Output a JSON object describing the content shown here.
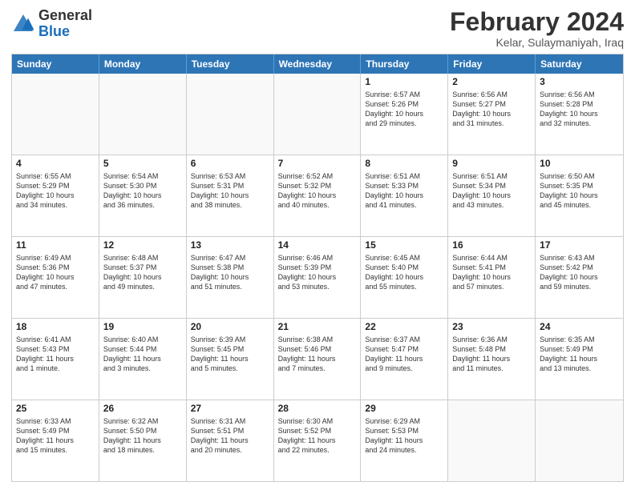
{
  "header": {
    "logo": {
      "general": "General",
      "blue": "Blue"
    },
    "title": "February 2024",
    "location": "Kelar, Sulaymaniyah, Iraq"
  },
  "weekdays": [
    "Sunday",
    "Monday",
    "Tuesday",
    "Wednesday",
    "Thursday",
    "Friday",
    "Saturday"
  ],
  "rows": [
    [
      {
        "day": "",
        "info": "",
        "empty": true
      },
      {
        "day": "",
        "info": "",
        "empty": true
      },
      {
        "day": "",
        "info": "",
        "empty": true
      },
      {
        "day": "",
        "info": "",
        "empty": true
      },
      {
        "day": "1",
        "info": "Sunrise: 6:57 AM\nSunset: 5:26 PM\nDaylight: 10 hours\nand 29 minutes."
      },
      {
        "day": "2",
        "info": "Sunrise: 6:56 AM\nSunset: 5:27 PM\nDaylight: 10 hours\nand 31 minutes."
      },
      {
        "day": "3",
        "info": "Sunrise: 6:56 AM\nSunset: 5:28 PM\nDaylight: 10 hours\nand 32 minutes."
      }
    ],
    [
      {
        "day": "4",
        "info": "Sunrise: 6:55 AM\nSunset: 5:29 PM\nDaylight: 10 hours\nand 34 minutes."
      },
      {
        "day": "5",
        "info": "Sunrise: 6:54 AM\nSunset: 5:30 PM\nDaylight: 10 hours\nand 36 minutes."
      },
      {
        "day": "6",
        "info": "Sunrise: 6:53 AM\nSunset: 5:31 PM\nDaylight: 10 hours\nand 38 minutes."
      },
      {
        "day": "7",
        "info": "Sunrise: 6:52 AM\nSunset: 5:32 PM\nDaylight: 10 hours\nand 40 minutes."
      },
      {
        "day": "8",
        "info": "Sunrise: 6:51 AM\nSunset: 5:33 PM\nDaylight: 10 hours\nand 41 minutes."
      },
      {
        "day": "9",
        "info": "Sunrise: 6:51 AM\nSunset: 5:34 PM\nDaylight: 10 hours\nand 43 minutes."
      },
      {
        "day": "10",
        "info": "Sunrise: 6:50 AM\nSunset: 5:35 PM\nDaylight: 10 hours\nand 45 minutes."
      }
    ],
    [
      {
        "day": "11",
        "info": "Sunrise: 6:49 AM\nSunset: 5:36 PM\nDaylight: 10 hours\nand 47 minutes."
      },
      {
        "day": "12",
        "info": "Sunrise: 6:48 AM\nSunset: 5:37 PM\nDaylight: 10 hours\nand 49 minutes."
      },
      {
        "day": "13",
        "info": "Sunrise: 6:47 AM\nSunset: 5:38 PM\nDaylight: 10 hours\nand 51 minutes."
      },
      {
        "day": "14",
        "info": "Sunrise: 6:46 AM\nSunset: 5:39 PM\nDaylight: 10 hours\nand 53 minutes."
      },
      {
        "day": "15",
        "info": "Sunrise: 6:45 AM\nSunset: 5:40 PM\nDaylight: 10 hours\nand 55 minutes."
      },
      {
        "day": "16",
        "info": "Sunrise: 6:44 AM\nSunset: 5:41 PM\nDaylight: 10 hours\nand 57 minutes."
      },
      {
        "day": "17",
        "info": "Sunrise: 6:43 AM\nSunset: 5:42 PM\nDaylight: 10 hours\nand 59 minutes."
      }
    ],
    [
      {
        "day": "18",
        "info": "Sunrise: 6:41 AM\nSunset: 5:43 PM\nDaylight: 11 hours\nand 1 minute."
      },
      {
        "day": "19",
        "info": "Sunrise: 6:40 AM\nSunset: 5:44 PM\nDaylight: 11 hours\nand 3 minutes."
      },
      {
        "day": "20",
        "info": "Sunrise: 6:39 AM\nSunset: 5:45 PM\nDaylight: 11 hours\nand 5 minutes."
      },
      {
        "day": "21",
        "info": "Sunrise: 6:38 AM\nSunset: 5:46 PM\nDaylight: 11 hours\nand 7 minutes."
      },
      {
        "day": "22",
        "info": "Sunrise: 6:37 AM\nSunset: 5:47 PM\nDaylight: 11 hours\nand 9 minutes."
      },
      {
        "day": "23",
        "info": "Sunrise: 6:36 AM\nSunset: 5:48 PM\nDaylight: 11 hours\nand 11 minutes."
      },
      {
        "day": "24",
        "info": "Sunrise: 6:35 AM\nSunset: 5:49 PM\nDaylight: 11 hours\nand 13 minutes."
      }
    ],
    [
      {
        "day": "25",
        "info": "Sunrise: 6:33 AM\nSunset: 5:49 PM\nDaylight: 11 hours\nand 15 minutes."
      },
      {
        "day": "26",
        "info": "Sunrise: 6:32 AM\nSunset: 5:50 PM\nDaylight: 11 hours\nand 18 minutes."
      },
      {
        "day": "27",
        "info": "Sunrise: 6:31 AM\nSunset: 5:51 PM\nDaylight: 11 hours\nand 20 minutes."
      },
      {
        "day": "28",
        "info": "Sunrise: 6:30 AM\nSunset: 5:52 PM\nDaylight: 11 hours\nand 22 minutes."
      },
      {
        "day": "29",
        "info": "Sunrise: 6:29 AM\nSunset: 5:53 PM\nDaylight: 11 hours\nand 24 minutes."
      },
      {
        "day": "",
        "info": "",
        "empty": true
      },
      {
        "day": "",
        "info": "",
        "empty": true
      }
    ]
  ]
}
